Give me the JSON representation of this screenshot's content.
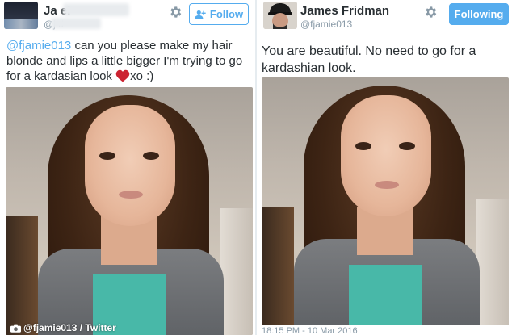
{
  "left_tweet": {
    "name": "Ja         el",
    "handle": "@j        d",
    "follow_label": "Follow",
    "text_mention": "@fjamie013",
    "text_body": " can you please make my hair blonde and lips a little bigger I'm trying to go for a kardasian look ",
    "text_after_heart": "xo :)",
    "caption": "@fjamie013 / Twitter"
  },
  "right_tweet": {
    "name": "James Fridman",
    "handle": "@fjamie013",
    "follow_label": "Following",
    "text": "You are beautiful. No need to go for a kardashian look.",
    "timestamp": "18:15 PM - 10 Mar 2016"
  },
  "colors": {
    "twitter_blue": "#55acee",
    "heart_red": "#cc2230",
    "muted_gray": "#8899a6"
  },
  "icons": {
    "gear": "gear-icon",
    "add_user": "add-user-icon",
    "heart": "heart-icon",
    "camera": "camera-icon"
  }
}
